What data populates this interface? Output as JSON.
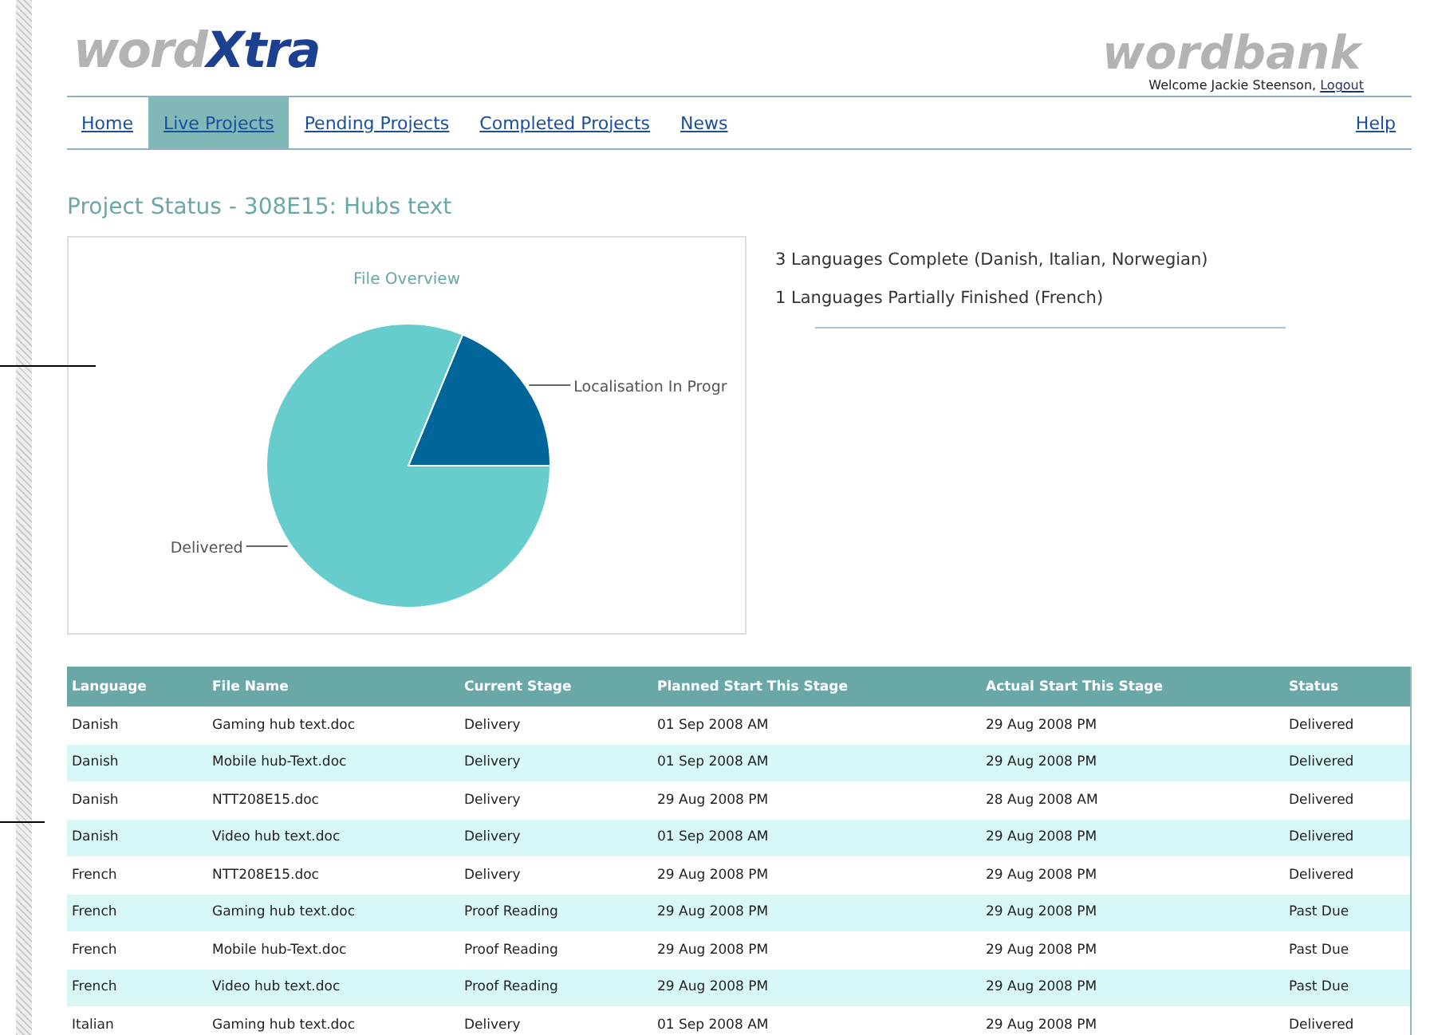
{
  "header": {
    "logo": {
      "light": "word",
      "strong": "Xtra"
    },
    "brand": "wordbank",
    "welcome": "Welcome Jackie Steenson,",
    "logout": "Logout"
  },
  "nav": {
    "tabs": [
      {
        "label": "Home",
        "selected": false
      },
      {
        "label": "Live Projects",
        "selected": true
      },
      {
        "label": "Pending Projects",
        "selected": false
      },
      {
        "label": "Completed Projects",
        "selected": false
      },
      {
        "label": "News",
        "selected": false
      }
    ],
    "help": "Help"
  },
  "page_title": "Project Status - 308E15: Hubs text",
  "chart_panel": {
    "chart_data": {
      "type": "pie",
      "title": "File Overview",
      "categories": [
        "Localisation In Progr",
        "Delivered"
      ],
      "values": [
        18.75,
        81.25
      ],
      "colors": [
        "#006699",
        "#66cccc"
      ]
    }
  },
  "summary": [
    "3 Languages Complete (Danish, Italian, Norwegian)",
    "1 Languages Partially Finished (French)"
  ],
  "table": {
    "columns": [
      "Language",
      "File Name",
      "Current Stage",
      "Planned Start This Stage",
      "Actual Start This Stage",
      "Status"
    ],
    "rows": [
      [
        "Danish",
        "Gaming hub text.doc",
        "Delivery",
        "01 Sep 2008 AM",
        "29 Aug 2008 PM",
        "Delivered"
      ],
      [
        "Danish",
        "Mobile hub-Text.doc",
        "Delivery",
        "01 Sep 2008 AM",
        "29 Aug 2008 PM",
        "Delivered"
      ],
      [
        "Danish",
        "NTT208E15.doc",
        "Delivery",
        "29 Aug 2008 PM",
        "28 Aug 2008 AM",
        "Delivered"
      ],
      [
        "Danish",
        "Video hub text.doc",
        "Delivery",
        "01 Sep 2008 AM",
        "29 Aug 2008 PM",
        "Delivered"
      ],
      [
        "French",
        "NTT208E15.doc",
        "Delivery",
        "29 Aug 2008 PM",
        "29 Aug 2008 PM",
        "Delivered"
      ],
      [
        "French",
        "Gaming hub text.doc",
        "Proof Reading",
        "29 Aug 2008 PM",
        "29 Aug 2008 PM",
        "Past Due"
      ],
      [
        "French",
        "Mobile hub-Text.doc",
        "Proof Reading",
        "29 Aug 2008 PM",
        "29 Aug 2008 PM",
        "Past Due"
      ],
      [
        "French",
        "Video hub text.doc",
        "Proof Reading",
        "29 Aug 2008 PM",
        "29 Aug 2008 PM",
        "Past Due"
      ],
      [
        "Italian",
        "Gaming hub text.doc",
        "Delivery",
        "01 Sep 2008 AM",
        "29 Aug 2008 PM",
        "Delivered"
      ]
    ]
  }
}
